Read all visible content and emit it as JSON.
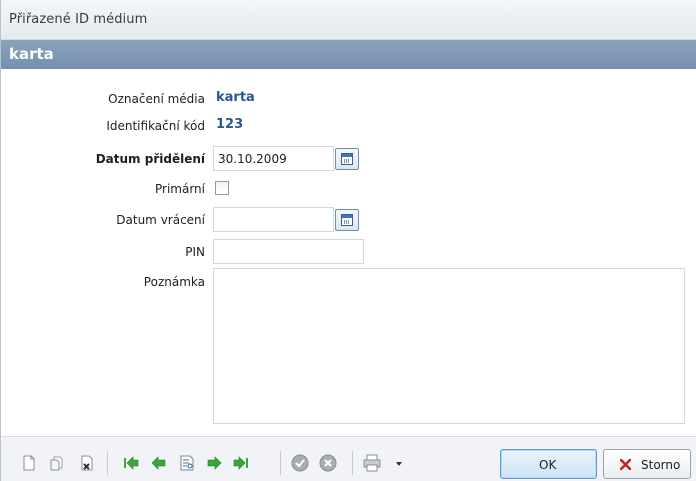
{
  "window": {
    "title": "Přiřazené ID médium"
  },
  "header": {
    "title": "karta"
  },
  "fields": {
    "media_label": {
      "label": "Označení média",
      "value": "karta"
    },
    "ident_code": {
      "label": "Identifikační kód",
      "value": "123"
    },
    "assign_date": {
      "label": "Datum přidělení",
      "value": "30.10.2009"
    },
    "primary": {
      "label": "Primární",
      "checked": false
    },
    "return_date": {
      "label": "Datum vrácení",
      "value": ""
    },
    "pin": {
      "label": "PIN",
      "value": ""
    },
    "note": {
      "label": "Poznámka",
      "value": ""
    }
  },
  "buttons": {
    "ok": "OK",
    "cancel": "Storno"
  },
  "colors": {
    "header_bg": "#7f99b6",
    "value_text": "#2a5597",
    "nav_green": "#3aa63a",
    "cancel_red": "#cc1f1f"
  }
}
